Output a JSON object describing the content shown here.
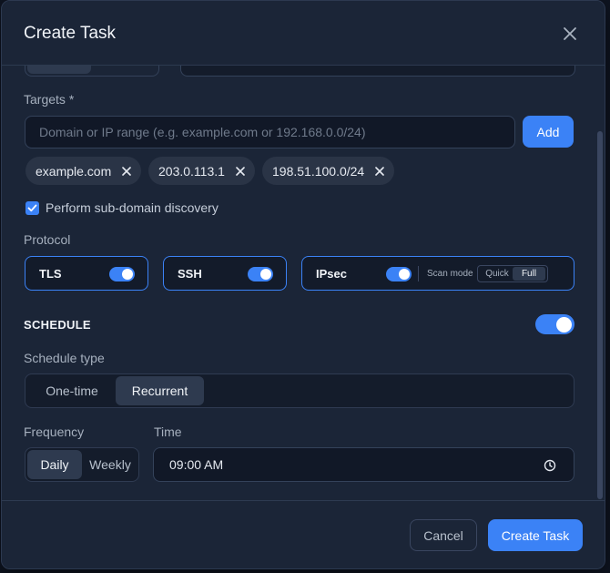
{
  "dialog": {
    "title": "Create Task"
  },
  "targets": {
    "label": "Targets",
    "required_mark": "*",
    "input_placeholder": "Domain or IP range (e.g. example.com or 192.168.0.0/24)",
    "input_value": "",
    "add_label": "Add",
    "chips": [
      "example.com",
      "203.0.113.1",
      "198.51.100.0/24"
    ]
  },
  "subdomain": {
    "label": "Perform sub-domain discovery",
    "checked": true
  },
  "protocol": {
    "label": "Protocol",
    "items": [
      {
        "name": "TLS",
        "enabled": true
      },
      {
        "name": "SSH",
        "enabled": true
      },
      {
        "name": "IPsec",
        "enabled": true
      }
    ],
    "scan_mode_label": "Scan mode",
    "scan_mode_options": [
      "Quick",
      "Full"
    ],
    "scan_mode_selected": "Full"
  },
  "schedule": {
    "title": "SCHEDULE",
    "enabled": true,
    "type_label": "Schedule type",
    "type_options": [
      "One-time",
      "Recurrent"
    ],
    "type_selected": "Recurrent",
    "frequency_label": "Frequency",
    "frequency_options": [
      "Daily",
      "Weekly"
    ],
    "frequency_selected": "Daily",
    "time_label": "Time",
    "time_value": "09:00 AM"
  },
  "footer": {
    "cancel_label": "Cancel",
    "create_label": "Create Task"
  },
  "colors": {
    "accent": "#3b82f6",
    "surface": "#1b2537",
    "field": "#111827"
  },
  "icons": {
    "close": "close-icon",
    "remove": "remove-chip-icon",
    "check": "checkmark-icon",
    "time": "clock-icon"
  }
}
